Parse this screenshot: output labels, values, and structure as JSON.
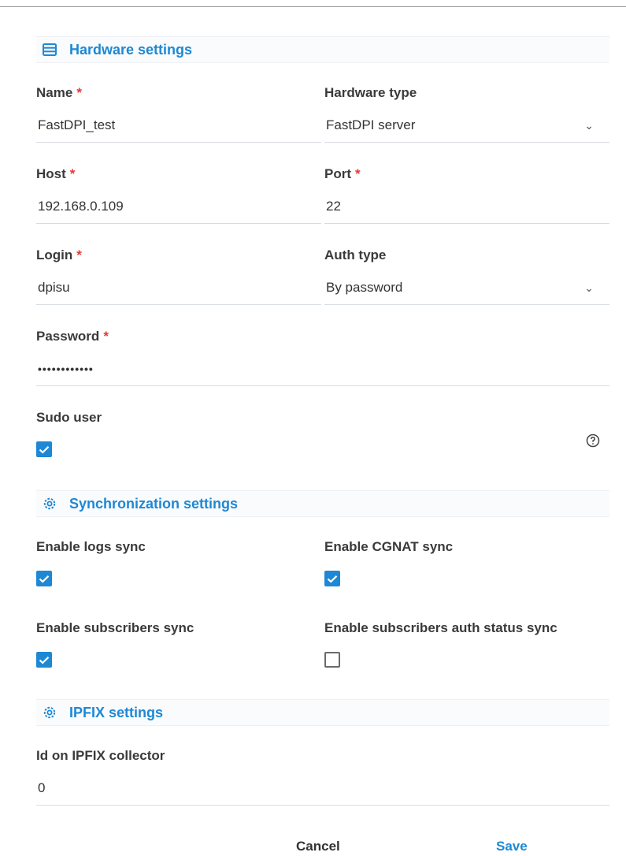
{
  "hardware": {
    "title": "Hardware settings",
    "name_label": "Name",
    "name_value": "FastDPI_test",
    "type_label": "Hardware type",
    "type_value": "FastDPI server",
    "host_label": "Host",
    "host_value": "192.168.0.109",
    "port_label": "Port",
    "port_value": "22",
    "login_label": "Login",
    "login_value": "dpisu",
    "auth_label": "Auth type",
    "auth_value": "By password",
    "password_label": "Password",
    "password_value": "••••••••••••",
    "sudo_label": "Sudo user",
    "sudo_checked": true,
    "required_mark": "*"
  },
  "sync": {
    "title": "Synchronization settings",
    "logs_label": "Enable logs sync",
    "logs_checked": true,
    "cgnat_label": "Enable CGNAT sync",
    "cgnat_checked": true,
    "subs_label": "Enable subscribers sync",
    "subs_checked": true,
    "auth_status_label": "Enable subscribers auth status sync",
    "auth_status_checked": false
  },
  "ipfix": {
    "title": "IPFIX settings",
    "id_label": "Id on IPFIX collector",
    "id_value": "0"
  },
  "actions": {
    "cancel_label": "Cancel",
    "save_label": "Save"
  },
  "colors": {
    "accent": "#1e88d4",
    "required": "#e53935"
  }
}
